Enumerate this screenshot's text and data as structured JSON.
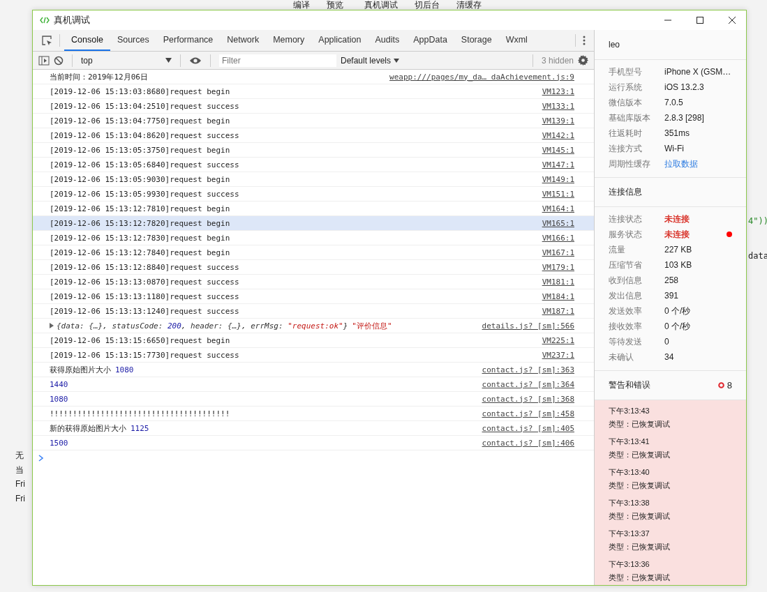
{
  "background_app": {
    "menu": [
      "编译",
      "预览",
      "真机调试",
      "切后台",
      "清缓存"
    ],
    "left_fragments": [
      "无",
      "当",
      "Fri",
      "Fri"
    ],
    "right_fragments": [
      "4\"))",
      "data"
    ]
  },
  "window": {
    "title": "真机调试"
  },
  "tabs": [
    {
      "label": "Console",
      "selected": true
    },
    {
      "label": "Sources",
      "selected": false
    },
    {
      "label": "Performance",
      "selected": false
    },
    {
      "label": "Network",
      "selected": false
    },
    {
      "label": "Memory",
      "selected": false
    },
    {
      "label": "Application",
      "selected": false
    },
    {
      "label": "Audits",
      "selected": false
    },
    {
      "label": "AppData",
      "selected": false
    },
    {
      "label": "Storage",
      "selected": false
    },
    {
      "label": "Wxml",
      "selected": false
    }
  ],
  "toolbar": {
    "context": "top",
    "filter_placeholder": "Filter",
    "levels": "Default levels",
    "hidden_count": "3 hidden"
  },
  "log": [
    {
      "selected": false,
      "segments": [
        {
          "kind": "plain",
          "text": "当前时间：2019年12月06日"
        }
      ],
      "source": "weapp:///pages/my_da… daAchievement.js:9"
    },
    {
      "selected": false,
      "segments": [
        {
          "kind": "plain",
          "text": "[2019-12-06 15:13:03:8680]request begin"
        }
      ],
      "source": "VM123:1"
    },
    {
      "selected": false,
      "segments": [
        {
          "kind": "plain",
          "text": "[2019-12-06 15:13:04:2510]request success"
        }
      ],
      "source": "VM133:1"
    },
    {
      "selected": false,
      "segments": [
        {
          "kind": "plain",
          "text": "[2019-12-06 15:13:04:7750]request begin"
        }
      ],
      "source": "VM139:1"
    },
    {
      "selected": false,
      "segments": [
        {
          "kind": "plain",
          "text": "[2019-12-06 15:13:04:8620]request success"
        }
      ],
      "source": "VM142:1"
    },
    {
      "selected": false,
      "segments": [
        {
          "kind": "plain",
          "text": "[2019-12-06 15:13:05:3750]request begin"
        }
      ],
      "source": "VM145:1"
    },
    {
      "selected": false,
      "segments": [
        {
          "kind": "plain",
          "text": "[2019-12-06 15:13:05:6840]request success"
        }
      ],
      "source": "VM147:1"
    },
    {
      "selected": false,
      "segments": [
        {
          "kind": "plain",
          "text": "[2019-12-06 15:13:05:9030]request begin"
        }
      ],
      "source": "VM149:1"
    },
    {
      "selected": false,
      "segments": [
        {
          "kind": "plain",
          "text": "[2019-12-06 15:13:05:9930]request success"
        }
      ],
      "source": "VM151:1"
    },
    {
      "selected": false,
      "segments": [
        {
          "kind": "plain",
          "text": "[2019-12-06 15:13:12:7810]request begin"
        }
      ],
      "source": "VM164:1"
    },
    {
      "selected": true,
      "segments": [
        {
          "kind": "plain",
          "text": "[2019-12-06 15:13:12:7820]request begin"
        }
      ],
      "source": "VM165:1"
    },
    {
      "selected": false,
      "segments": [
        {
          "kind": "plain",
          "text": "[2019-12-06 15:13:12:7830]request begin"
        }
      ],
      "source": "VM166:1"
    },
    {
      "selected": false,
      "segments": [
        {
          "kind": "plain",
          "text": "[2019-12-06 15:13:12:7840]request begin"
        }
      ],
      "source": "VM167:1"
    },
    {
      "selected": false,
      "segments": [
        {
          "kind": "plain",
          "text": "[2019-12-06 15:13:12:8840]request success"
        }
      ],
      "source": "VM179:1"
    },
    {
      "selected": false,
      "segments": [
        {
          "kind": "plain",
          "text": "[2019-12-06 15:13:13:0870]request success"
        }
      ],
      "source": "VM181:1"
    },
    {
      "selected": false,
      "segments": [
        {
          "kind": "plain",
          "text": "[2019-12-06 15:13:13:1180]request success"
        }
      ],
      "source": "VM184:1"
    },
    {
      "selected": false,
      "segments": [
        {
          "kind": "plain",
          "text": "[2019-12-06 15:13:13:1240]request success"
        }
      ],
      "source": "VM187:1"
    },
    {
      "selected": false,
      "segments": [
        {
          "kind": "object",
          "text": "{data: {…}, statusCode: "
        },
        {
          "kind": "objnum",
          "text": "200"
        },
        {
          "kind": "object",
          "text": ", header: {…}, errMsg: "
        },
        {
          "kind": "string",
          "text": "\"request:ok\""
        },
        {
          "kind": "object",
          "text": "}"
        },
        {
          "kind": "label",
          "text": "\"评价信息\""
        }
      ],
      "source": "details.js? [sm]:566"
    },
    {
      "selected": false,
      "segments": [
        {
          "kind": "plain",
          "text": "[2019-12-06 15:13:15:6650]request begin"
        }
      ],
      "source": "VM225:1"
    },
    {
      "selected": false,
      "segments": [
        {
          "kind": "plain",
          "text": "[2019-12-06 15:13:15:7730]request success"
        }
      ],
      "source": "VM237:1"
    },
    {
      "selected": false,
      "segments": [
        {
          "kind": "plain",
          "text": "获得原始图片大小"
        },
        {
          "kind": "number",
          "text": "1080"
        }
      ],
      "source": "contact.js? [sm]:363"
    },
    {
      "selected": false,
      "segments": [
        {
          "kind": "number",
          "text": "1440"
        }
      ],
      "source": "contact.js? [sm]:364"
    },
    {
      "selected": false,
      "segments": [
        {
          "kind": "number",
          "text": "1080"
        }
      ],
      "source": "contact.js? [sm]:368"
    },
    {
      "selected": false,
      "segments": [
        {
          "kind": "plain",
          "text": "!!!!!!!!!!!!!!!!!!!!!!!!!!!!!!!!!!!!!!!"
        }
      ],
      "source": "contact.js? [sm]:458"
    },
    {
      "selected": false,
      "segments": [
        {
          "kind": "plain",
          "text": "新的获得原始图片大小"
        },
        {
          "kind": "number",
          "text": "1125"
        }
      ],
      "source": "contact.js? [sm]:405"
    },
    {
      "selected": false,
      "segments": [
        {
          "kind": "number",
          "text": "1500"
        }
      ],
      "source": "contact.js? [sm]:406"
    }
  ],
  "sidebar": {
    "user": "leo",
    "device": [
      {
        "label": "手机型号",
        "value": "iPhone X (GSM…",
        "link": false
      },
      {
        "label": "运行系统",
        "value": "iOS 13.2.3",
        "link": false
      },
      {
        "label": "微信版本",
        "value": "7.0.5",
        "link": false
      },
      {
        "label": "基础库版本",
        "value": "2.8.3 [298]",
        "link": false
      },
      {
        "label": "往返耗时",
        "value": "351ms",
        "link": false
      },
      {
        "label": "连接方式",
        "value": "Wi-Fi",
        "link": false
      },
      {
        "label": "周期性缓存",
        "value": "拉取数据",
        "link": true
      }
    ],
    "connection_title": "连接信息",
    "connection": [
      {
        "label": "连接状态",
        "value": "未连接",
        "error": true,
        "dot": false
      },
      {
        "label": "服务状态",
        "value": "未连接",
        "error": true,
        "dot": true
      },
      {
        "label": "流量",
        "value": "227 KB",
        "error": false,
        "dot": false
      },
      {
        "label": "压缩节省",
        "value": "103 KB",
        "error": false,
        "dot": false
      },
      {
        "label": "收到信息",
        "value": "258",
        "error": false,
        "dot": false
      },
      {
        "label": "发出信息",
        "value": "391",
        "error": false,
        "dot": false
      },
      {
        "label": "发送效率",
        "value": "0 个/秒",
        "error": false,
        "dot": false
      },
      {
        "label": "接收效率",
        "value": "0 个/秒",
        "error": false,
        "dot": false
      },
      {
        "label": "等待发送",
        "value": "0",
        "error": false,
        "dot": false
      },
      {
        "label": "未确认",
        "value": "34",
        "error": false,
        "dot": false
      }
    ],
    "warnings_title": "警告和错误",
    "warnings_count": "8",
    "warnings": [
      {
        "time": "下午3:13:43",
        "type": "类型：已恢复调试"
      },
      {
        "time": "下午3:13:41",
        "type": "类型：已恢复调试"
      },
      {
        "time": "下午3:13:40",
        "type": "类型：已恢复调试"
      },
      {
        "time": "下午3:13:38",
        "type": "类型：已恢复调试"
      },
      {
        "time": "下午3:13:37",
        "type": "类型：已恢复调试"
      },
      {
        "time": "下午3:13:36",
        "type": "类型：已恢复调试"
      }
    ]
  }
}
